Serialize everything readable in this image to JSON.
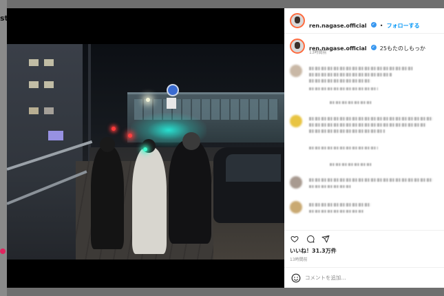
{
  "page": {
    "fragment": "st"
  },
  "post": {
    "username": "ren.nagase.official",
    "follow_label": "フォローする",
    "separator": "•",
    "caption": "25もたのしもっか",
    "caption_time": "13時間前",
    "likes": "いいね！31.3万件",
    "time": "13時間前",
    "add_comment_placeholder": "コメントを追加..."
  },
  "icons": {
    "verified": "verified-badge-icon",
    "like": "heart-icon",
    "comment": "comment-icon",
    "share": "share-icon",
    "emoji": "emoji-icon"
  },
  "colors": {
    "follow": "#0095f6",
    "verified": "#3897f0",
    "avatar_ring": "#ff6a3d"
  }
}
